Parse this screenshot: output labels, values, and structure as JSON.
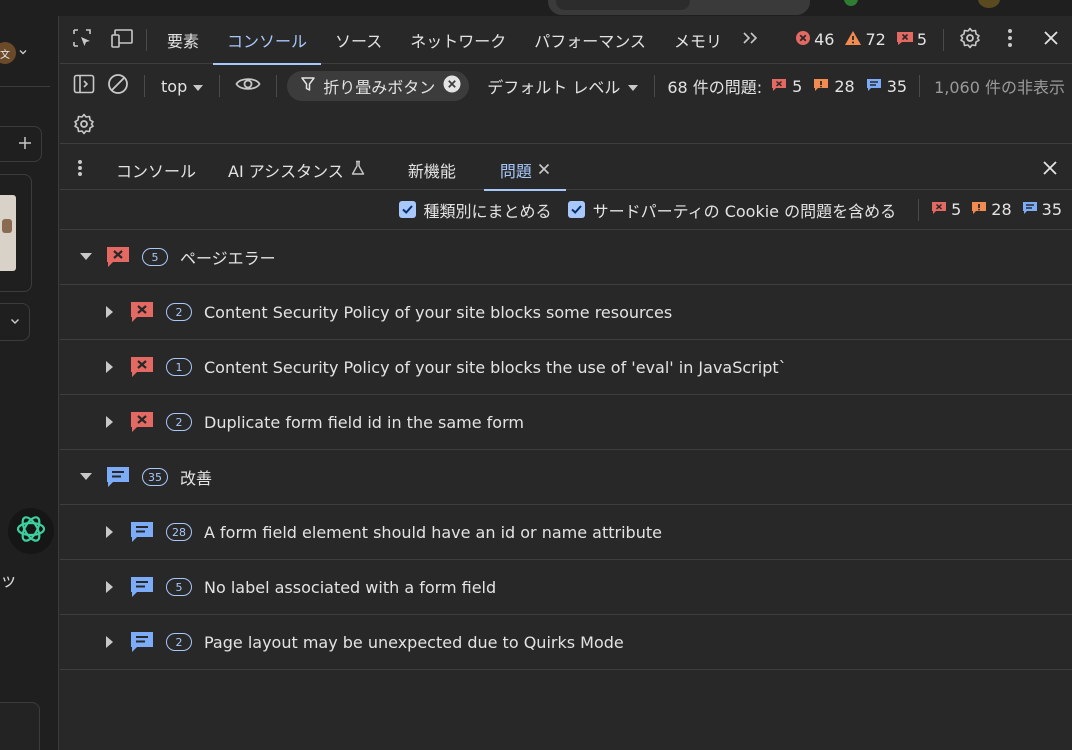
{
  "colors": {
    "error": "#e46962",
    "warning": "#f28b50",
    "info": "#7cacf8",
    "accent": "#a8c7fa"
  },
  "browser_side": {
    "lang_label": "文",
    "side_text": "ッ"
  },
  "main_tabs": [
    {
      "label": "要素"
    },
    {
      "label": "コンソール"
    },
    {
      "label": "ソース"
    },
    {
      "label": "ネットワーク"
    },
    {
      "label": "パフォーマンス"
    },
    {
      "label": "メモリ"
    }
  ],
  "main_counters": {
    "errors": "46",
    "warnings": "72",
    "issues": "5"
  },
  "toolbar": {
    "context": "top",
    "filter_chip": "折り畳みボタン",
    "level": "デフォルト レベル",
    "issues_label": "68 件の問題:",
    "issue_errors": "5",
    "issue_warnings": "28",
    "issue_info": "35",
    "hidden": "1,060 件の非表示"
  },
  "drawer_tabs": [
    {
      "label": "コンソール"
    },
    {
      "label": "AI アシスタンス"
    },
    {
      "label": "新機能"
    },
    {
      "label": "問題"
    }
  ],
  "issues_toolbar": {
    "group_by_kind": "種類別にまとめる",
    "include_third_party": "サードパーティの Cookie の問題を含める",
    "errors": "5",
    "warnings": "28",
    "info": "35"
  },
  "categories": [
    {
      "label": "ページエラー",
      "count": "5",
      "severity": "error",
      "items": [
        {
          "count": "2",
          "title": "Content Security Policy of your site blocks some resources"
        },
        {
          "count": "1",
          "title": "Content Security Policy of your site blocks the use of 'eval' in JavaScript`"
        },
        {
          "count": "2",
          "title": "Duplicate form field id in the same form"
        }
      ]
    },
    {
      "label": "改善",
      "count": "35",
      "severity": "info",
      "items": [
        {
          "count": "28",
          "title": "A form field element should have an id or name attribute"
        },
        {
          "count": "5",
          "title": "No label associated with a form field"
        },
        {
          "count": "2",
          "title": "Page layout may be unexpected due to Quirks Mode"
        }
      ]
    }
  ]
}
